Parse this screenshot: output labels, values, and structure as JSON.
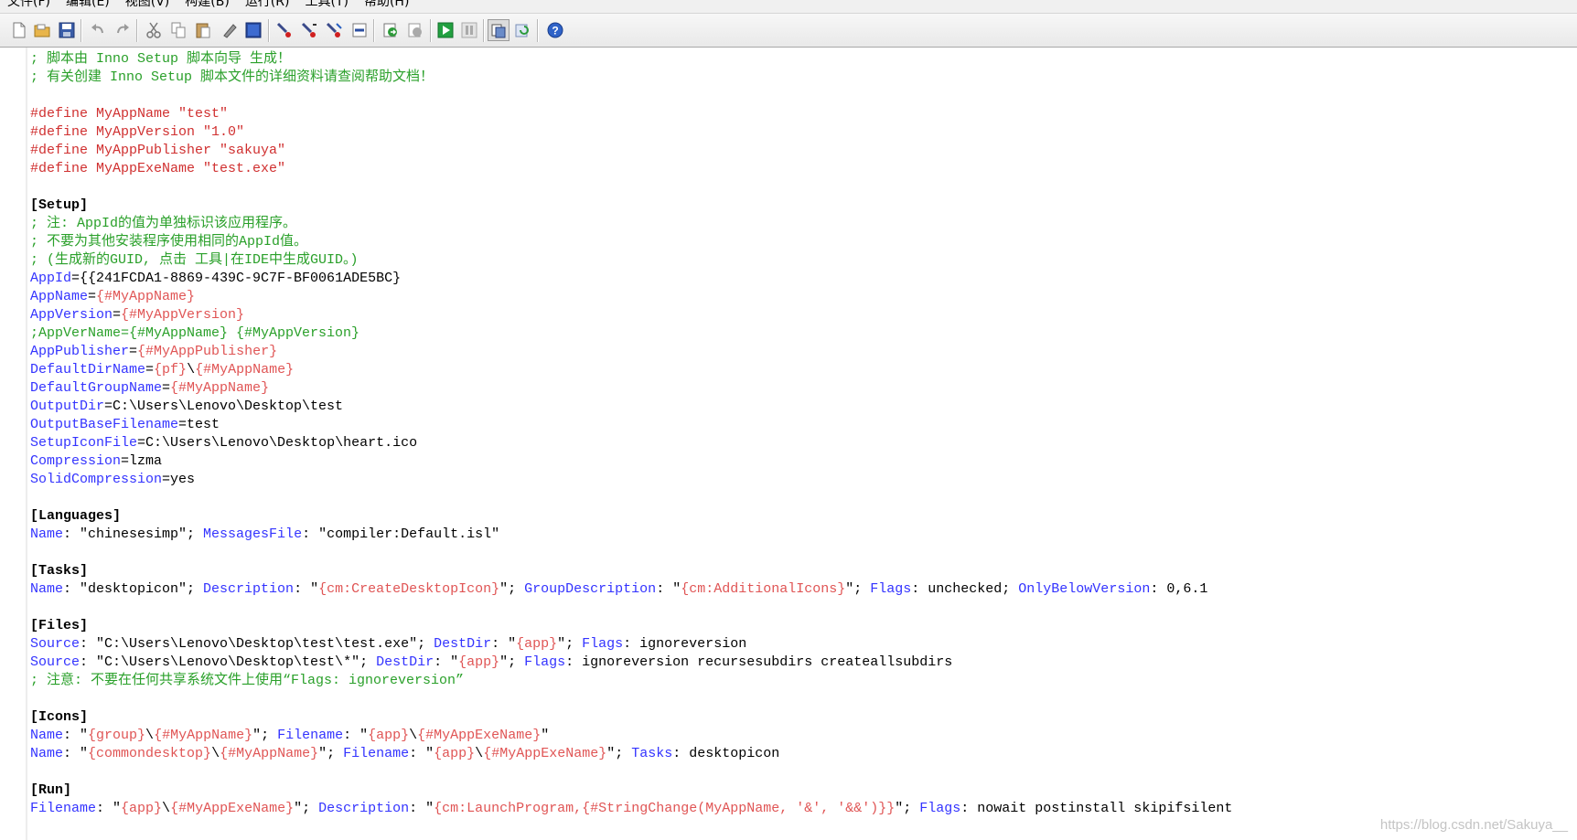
{
  "menu": [
    "文件(F)",
    "编辑(E)",
    "视图(V)",
    "构建(B)",
    "运行(R)",
    "工具(T)",
    "帮助(H)"
  ],
  "code_lines": [
    {
      "parts": [
        {
          "t": "; 脚本由 Inno Setup 脚本向导 生成！",
          "c": "c"
        }
      ]
    },
    {
      "parts": [
        {
          "t": "; 有关创建 Inno Setup 脚本文件的详细资料请查阅帮助文档！",
          "c": "c"
        }
      ]
    },
    {
      "parts": []
    },
    {
      "parts": [
        {
          "t": "#define MyAppName \"test\"",
          "c": "d"
        }
      ]
    },
    {
      "parts": [
        {
          "t": "#define MyAppVersion \"1.0\"",
          "c": "d"
        }
      ]
    },
    {
      "parts": [
        {
          "t": "#define MyAppPublisher \"sakuya\"",
          "c": "d"
        }
      ]
    },
    {
      "parts": [
        {
          "t": "#define MyAppExeName \"test.exe\"",
          "c": "d"
        }
      ]
    },
    {
      "parts": []
    },
    {
      "parts": [
        {
          "t": "[Setup]",
          "c": "s"
        }
      ]
    },
    {
      "parts": [
        {
          "t": "; 注: AppId的值为单独标识该应用程序。",
          "c": "c"
        }
      ]
    },
    {
      "parts": [
        {
          "t": "; 不要为其他安装程序使用相同的AppId值。",
          "c": "c"
        }
      ]
    },
    {
      "parts": [
        {
          "t": "; (生成新的GUID, 点击 工具|在IDE中生成GUID。)",
          "c": "c"
        }
      ]
    },
    {
      "parts": [
        {
          "t": "AppId",
          "c": "k"
        },
        {
          "t": "={{241FCDA1-8869-439C-9C7F-BF0061ADE5BC}",
          "c": "p"
        }
      ]
    },
    {
      "parts": [
        {
          "t": "AppName",
          "c": "k"
        },
        {
          "t": "=",
          "c": "p"
        },
        {
          "t": "{#MyAppName}",
          "c": "cn"
        }
      ]
    },
    {
      "parts": [
        {
          "t": "AppVersion",
          "c": "k"
        },
        {
          "t": "=",
          "c": "p"
        },
        {
          "t": "{#MyAppVersion}",
          "c": "cn"
        }
      ]
    },
    {
      "parts": [
        {
          "t": ";AppVerName={#MyAppName} {#MyAppVersion}",
          "c": "c"
        }
      ]
    },
    {
      "parts": [
        {
          "t": "AppPublisher",
          "c": "k"
        },
        {
          "t": "=",
          "c": "p"
        },
        {
          "t": "{#MyAppPublisher}",
          "c": "cn"
        }
      ]
    },
    {
      "parts": [
        {
          "t": "DefaultDirName",
          "c": "k"
        },
        {
          "t": "=",
          "c": "p"
        },
        {
          "t": "{pf}",
          "c": "cn"
        },
        {
          "t": "\\",
          "c": "p"
        },
        {
          "t": "{#MyAppName}",
          "c": "cn"
        }
      ]
    },
    {
      "parts": [
        {
          "t": "DefaultGroupName",
          "c": "k"
        },
        {
          "t": "=",
          "c": "p"
        },
        {
          "t": "{#MyAppName}",
          "c": "cn"
        }
      ]
    },
    {
      "parts": [
        {
          "t": "OutputDir",
          "c": "k"
        },
        {
          "t": "=C:\\Users\\Lenovo\\Desktop\\test",
          "c": "p"
        }
      ]
    },
    {
      "parts": [
        {
          "t": "OutputBaseFilename",
          "c": "k"
        },
        {
          "t": "=test",
          "c": "p"
        }
      ]
    },
    {
      "parts": [
        {
          "t": "SetupIconFile",
          "c": "k"
        },
        {
          "t": "=C:\\Users\\Lenovo\\Desktop\\heart.ico",
          "c": "p"
        }
      ]
    },
    {
      "parts": [
        {
          "t": "Compression",
          "c": "k"
        },
        {
          "t": "=lzma",
          "c": "p"
        }
      ]
    },
    {
      "parts": [
        {
          "t": "SolidCompression",
          "c": "k"
        },
        {
          "t": "=yes",
          "c": "p"
        }
      ]
    },
    {
      "parts": []
    },
    {
      "parts": [
        {
          "t": "[Languages]",
          "c": "s"
        }
      ]
    },
    {
      "parts": [
        {
          "t": "Name",
          "c": "k"
        },
        {
          "t": ": \"chinesesimp\"; ",
          "c": "p"
        },
        {
          "t": "MessagesFile",
          "c": "k"
        },
        {
          "t": ": \"compiler:Default.isl\"",
          "c": "p"
        }
      ]
    },
    {
      "parts": []
    },
    {
      "parts": [
        {
          "t": "[Tasks]",
          "c": "s"
        }
      ]
    },
    {
      "parts": [
        {
          "t": "Name",
          "c": "k"
        },
        {
          "t": ": \"desktopicon\"; ",
          "c": "p"
        },
        {
          "t": "Description",
          "c": "k"
        },
        {
          "t": ": \"",
          "c": "p"
        },
        {
          "t": "{cm:CreateDesktopIcon}",
          "c": "cn"
        },
        {
          "t": "\"; ",
          "c": "p"
        },
        {
          "t": "GroupDescription",
          "c": "k"
        },
        {
          "t": ": \"",
          "c": "p"
        },
        {
          "t": "{cm:AdditionalIcons}",
          "c": "cn"
        },
        {
          "t": "\"; ",
          "c": "p"
        },
        {
          "t": "Flags",
          "c": "k"
        },
        {
          "t": ": unchecked; ",
          "c": "p"
        },
        {
          "t": "OnlyBelowVersion",
          "c": "k"
        },
        {
          "t": ": 0,6.1",
          "c": "p"
        }
      ]
    },
    {
      "parts": []
    },
    {
      "parts": [
        {
          "t": "[Files]",
          "c": "s"
        }
      ]
    },
    {
      "parts": [
        {
          "t": "Source",
          "c": "k"
        },
        {
          "t": ": \"C:\\Users\\Lenovo\\Desktop\\test\\test.exe\"; ",
          "c": "p"
        },
        {
          "t": "DestDir",
          "c": "k"
        },
        {
          "t": ": \"",
          "c": "p"
        },
        {
          "t": "{app}",
          "c": "cn"
        },
        {
          "t": "\"; ",
          "c": "p"
        },
        {
          "t": "Flags",
          "c": "k"
        },
        {
          "t": ": ignoreversion",
          "c": "p"
        }
      ]
    },
    {
      "parts": [
        {
          "t": "Source",
          "c": "k"
        },
        {
          "t": ": \"C:\\Users\\Lenovo\\Desktop\\test\\*\"; ",
          "c": "p"
        },
        {
          "t": "DestDir",
          "c": "k"
        },
        {
          "t": ": \"",
          "c": "p"
        },
        {
          "t": "{app}",
          "c": "cn"
        },
        {
          "t": "\"; ",
          "c": "p"
        },
        {
          "t": "Flags",
          "c": "k"
        },
        {
          "t": ": ignoreversion recursesubdirs createallsubdirs",
          "c": "p"
        }
      ]
    },
    {
      "parts": [
        {
          "t": "; 注意: 不要在任何共享系统文件上使用“Flags: ignoreversion”",
          "c": "c"
        }
      ]
    },
    {
      "parts": []
    },
    {
      "parts": [
        {
          "t": "[Icons]",
          "c": "s"
        }
      ]
    },
    {
      "parts": [
        {
          "t": "Name",
          "c": "k"
        },
        {
          "t": ": \"",
          "c": "p"
        },
        {
          "t": "{group}",
          "c": "cn"
        },
        {
          "t": "\\",
          "c": "p"
        },
        {
          "t": "{#MyAppName}",
          "c": "cn"
        },
        {
          "t": "\"; ",
          "c": "p"
        },
        {
          "t": "Filename",
          "c": "k"
        },
        {
          "t": ": \"",
          "c": "p"
        },
        {
          "t": "{app}",
          "c": "cn"
        },
        {
          "t": "\\",
          "c": "p"
        },
        {
          "t": "{#MyAppExeName}",
          "c": "cn"
        },
        {
          "t": "\"",
          "c": "p"
        }
      ]
    },
    {
      "parts": [
        {
          "t": "Name",
          "c": "k"
        },
        {
          "t": ": \"",
          "c": "p"
        },
        {
          "t": "{commondesktop}",
          "c": "cn"
        },
        {
          "t": "\\",
          "c": "p"
        },
        {
          "t": "{#MyAppName}",
          "c": "cn"
        },
        {
          "t": "\"; ",
          "c": "p"
        },
        {
          "t": "Filename",
          "c": "k"
        },
        {
          "t": ": \"",
          "c": "p"
        },
        {
          "t": "{app}",
          "c": "cn"
        },
        {
          "t": "\\",
          "c": "p"
        },
        {
          "t": "{#MyAppExeName}",
          "c": "cn"
        },
        {
          "t": "\"; ",
          "c": "p"
        },
        {
          "t": "Tasks",
          "c": "k"
        },
        {
          "t": ": desktopicon",
          "c": "p"
        }
      ]
    },
    {
      "parts": []
    },
    {
      "parts": [
        {
          "t": "[Run]",
          "c": "s"
        }
      ]
    },
    {
      "parts": [
        {
          "t": "Filename",
          "c": "k"
        },
        {
          "t": ": \"",
          "c": "p"
        },
        {
          "t": "{app}",
          "c": "cn"
        },
        {
          "t": "\\",
          "c": "p"
        },
        {
          "t": "{#MyAppExeName}",
          "c": "cn"
        },
        {
          "t": "\"; ",
          "c": "p"
        },
        {
          "t": "Description",
          "c": "k"
        },
        {
          "t": ": \"",
          "c": "p"
        },
        {
          "t": "{cm:LaunchProgram,{#StringChange(MyAppName, '&', '&&')}}",
          "c": "cn"
        },
        {
          "t": "\"; ",
          "c": "p"
        },
        {
          "t": "Flags",
          "c": "k"
        },
        {
          "t": ": nowait postinstall skipifsilent",
          "c": "p"
        }
      ]
    }
  ],
  "watermark": "https://blog.csdn.net/Sakuya__",
  "colors": {
    "comment": "#2aa02a",
    "define": "#d03030",
    "key": "#3333ff",
    "constant": "#e05555"
  }
}
